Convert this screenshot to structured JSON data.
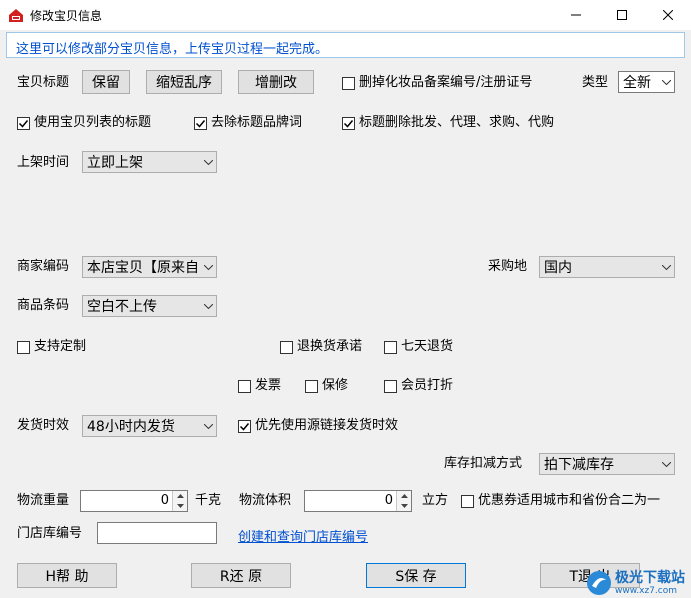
{
  "window": {
    "title": "修改宝贝信息"
  },
  "info": "这里可以修改部分宝贝信息，上传宝贝过程一起完成。",
  "title_row": {
    "label": "宝贝标题",
    "btn_keep": "保留",
    "btn_shorten": "缩短乱序",
    "btn_edit": "增删改",
    "chk_delete_cosmetic": "删掉化妆品备案编号/注册证号",
    "type_label": "类型",
    "type_value": "全新"
  },
  "options_row": {
    "use_list_title": "使用宝贝列表的标题",
    "remove_brand": "去除标题品牌词",
    "remove_wholesale": "标题删除批发、代理、求购、代购"
  },
  "listing": {
    "label": "上架时间",
    "value": "立即上架"
  },
  "merchant": {
    "label": "商家编码",
    "value": "本店宝贝【原来自"
  },
  "purchase": {
    "label": "采购地",
    "value": "国内"
  },
  "barcode": {
    "label": "商品条码",
    "value": "空白不上传"
  },
  "custom": {
    "label": "支持定制"
  },
  "returns": {
    "exchange": "退换货承诺",
    "seven_day": "七天退货"
  },
  "extras": {
    "invoice": "发票",
    "warranty": "保修",
    "member_discount": "会员打折"
  },
  "delivery": {
    "label": "发货时效",
    "value": "48小时内发货",
    "prefer_source": "优先使用源链接发货时效"
  },
  "stock": {
    "label": "库存扣减方式",
    "value": "拍下减库存"
  },
  "logistics": {
    "weight_label": "物流重量",
    "weight_value": "0",
    "weight_unit": "千克",
    "volume_label": "物流体积",
    "volume_value": "0",
    "volume_unit": "立方",
    "coupon": "优惠券适用城市和省份合二为一"
  },
  "store": {
    "label": "门店库编号",
    "value": "",
    "link": "创建和查询门店库编号"
  },
  "footer": {
    "help": "H帮  助",
    "restore": "R还  原",
    "save": "S保  存",
    "exit": "T退  出"
  },
  "watermark": {
    "brand": "极光下载站",
    "url": "www.xz7.com"
  },
  "colors": {
    "accent": "#0050d0",
    "link": "#0050d0",
    "titlebar": "#ffffff",
    "background": "#f0f0f0"
  }
}
